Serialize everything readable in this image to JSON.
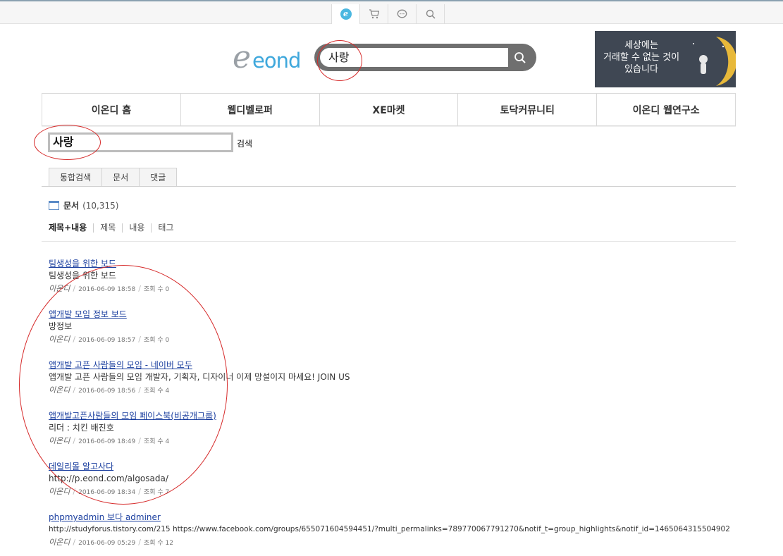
{
  "top_icons": [
    {
      "name": "eond-icon"
    },
    {
      "name": "cart-icon"
    },
    {
      "name": "chat-icon"
    },
    {
      "name": "search-icon"
    }
  ],
  "header": {
    "logo_e": "e",
    "logo_text": "eond",
    "search_value": "사랑",
    "banner_lines": [
      "세상에는",
      "거래할 수 없는 것이",
      "있습니다"
    ]
  },
  "gnb": [
    "이온디 홈",
    "웹디벨로퍼",
    "XE마켓",
    "토닥커뮤니티",
    "이온디 웹연구소"
  ],
  "search": {
    "query": "사랑",
    "button": "검색"
  },
  "tabs": [
    "통합검색",
    "문서",
    "댓글"
  ],
  "section": {
    "label": "문서",
    "count": "(10,315)"
  },
  "filters": [
    "제목+내용",
    "제목",
    "내용",
    "태그"
  ],
  "results": [
    {
      "title": "팀생성을 위한 보드",
      "summary": "팀생성을 위한 보드",
      "author": "이온디",
      "date": "2016-06-09 18:58",
      "views": "조회 수 0"
    },
    {
      "title": "앱개발 모임 정보 보드",
      "summary": "방정보",
      "author": "이온디",
      "date": "2016-06-09 18:57",
      "views": "조회 수 0"
    },
    {
      "title": "앱개발 고픈 사람들의 모임 - 네이버 모두",
      "summary": "앱개발 고픈 사람들의 모임 개발자, 기획자, 디자이너 이제 망설이지 마세요! JOIN US",
      "author": "이온디",
      "date": "2016-06-09 18:56",
      "views": "조회 수 4"
    },
    {
      "title": "앱개발고픈사람들의 모임 페이스북(비공개그룹)",
      "summary": "리더 : 치킨 배진호",
      "author": "이온디",
      "date": "2016-06-09 18:49",
      "views": "조회 수 4"
    },
    {
      "title": "데일리몰 알고사다",
      "summary": "http://p.eond.com/algosada/",
      "author": "이온디",
      "date": "2016-06-09 18:34",
      "views": "조회 수 7"
    },
    {
      "title": "phpmyadmin 보다 adminer",
      "summary": "http://studyforus.tistory.com/215 https://www.facebook.com/groups/655071604594451/?multi_permalinks=789770067791270&notif_t=group_highlights&notif_id=1465064315504902",
      "author": "이온디",
      "date": "2016-06-09 05:29",
      "views": "조회 수 12"
    }
  ],
  "colors": {
    "accent": "#3fa8dc",
    "link": "#1b3f9f",
    "annotation": "#d62b2b"
  }
}
